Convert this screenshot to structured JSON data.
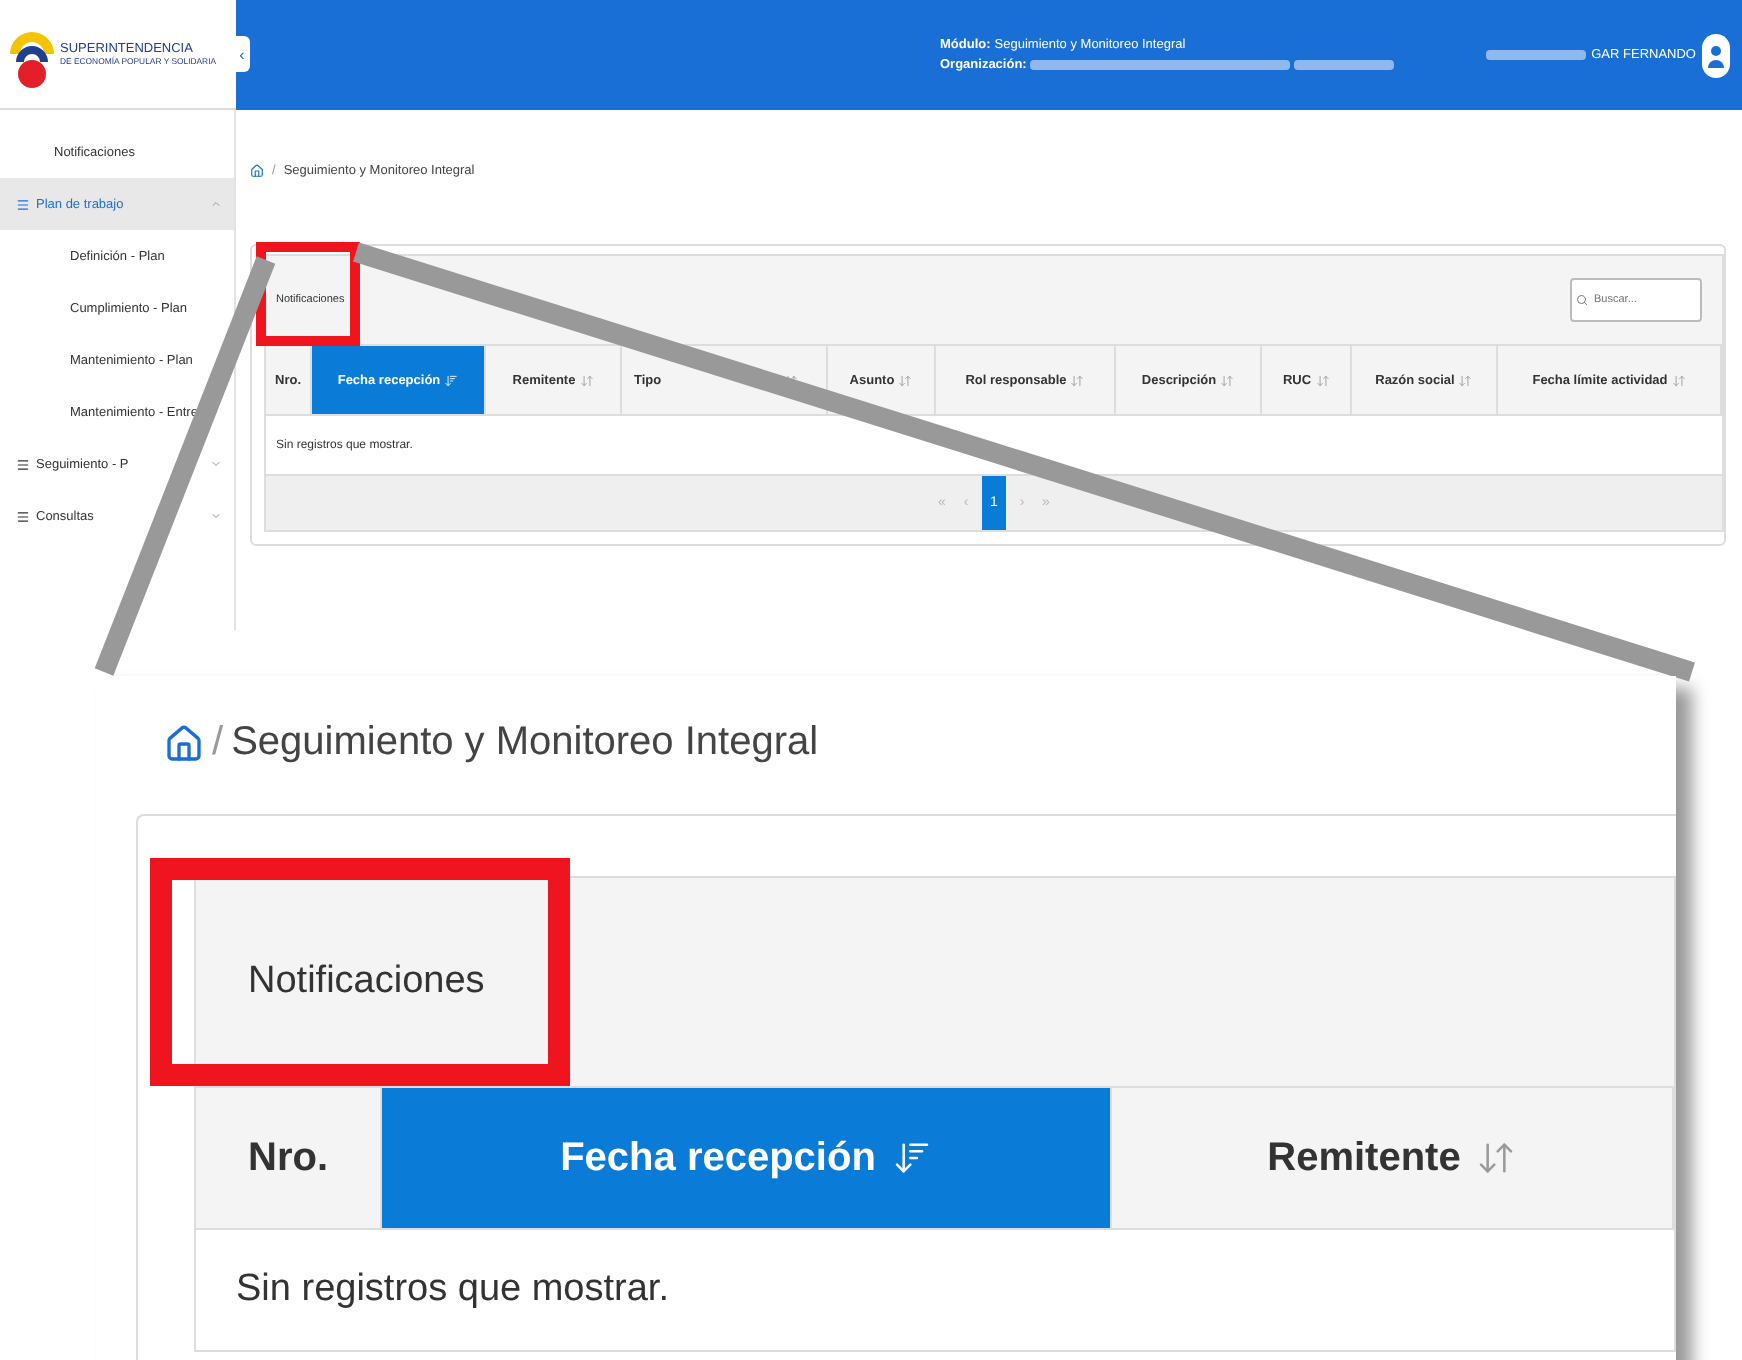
{
  "header": {
    "logo_text": "SUPERINTENDENCIA",
    "logo_subtext": "DE ECONOMÍA POPULAR Y SOLIDARIA",
    "collapse": "‹",
    "module_label": "Módulo:",
    "module": "Seguimiento y Monitoreo Integral",
    "organization_label": "Organización:",
    "user": "GAR FERNANDO"
  },
  "sidebar": {
    "items": [
      {
        "label": "Notificaciones",
        "kind": "link",
        "selected": false
      },
      {
        "label": "Plan de trabajo",
        "kind": "group",
        "selected": true,
        "expanded": true,
        "children": [
          {
            "label": "Definición - Plan"
          },
          {
            "label": "Cumplimiento - Plan"
          },
          {
            "label": "Mantenimiento - Plan"
          },
          {
            "label": "Mantenimiento - Entre"
          }
        ]
      },
      {
        "label": "Seguimiento - P",
        "kind": "group",
        "selected": false,
        "expanded": false
      },
      {
        "label": "Consultas",
        "kind": "group",
        "selected": false,
        "expanded": false
      }
    ]
  },
  "breadcrumb": {
    "separator": "/",
    "current": "Seguimiento y Monitoreo Integral"
  },
  "card": {
    "title": "Notificaciones",
    "highlighted": true,
    "search": {
      "placeholder": "Buscar..."
    },
    "columns": [
      {
        "label": "Nro.",
        "sortable": false,
        "selected": false
      },
      {
        "label": "Fecha recepción",
        "sortable": true,
        "selected": true
      },
      {
        "label": "Remitente",
        "sortable": true,
        "selected": false
      },
      {
        "label": "Tipo",
        "sortable": true,
        "selected": false
      },
      {
        "label": "Asunto",
        "sortable": true,
        "selected": false
      },
      {
        "label": "Rol responsable",
        "sortable": true,
        "selected": false
      },
      {
        "label": "Descripción",
        "sortable": true,
        "selected": false
      },
      {
        "label": "RUC",
        "sortable": true,
        "selected": false
      },
      {
        "label": "Razón social",
        "sortable": true,
        "selected": false
      },
      {
        "label": "Fecha límite actividad",
        "sortable": true,
        "selected": false
      }
    ],
    "empty": "Sin registros que mostrar.",
    "pagination": [
      {
        "label": "«",
        "selected": false
      },
      {
        "label": "‹",
        "selected": false
      },
      {
        "label": "1",
        "selected": true
      },
      {
        "label": "›",
        "selected": false
      },
      {
        "label": "»",
        "selected": false
      }
    ]
  },
  "zoom_inset": {
    "breadcrumb": {
      "separator": "/",
      "current": "Seguimiento y Monitoreo Integral"
    },
    "title": "Notificaciones",
    "highlighted": true,
    "columns": [
      {
        "label": "Nro.",
        "sortable": false,
        "selected": false
      },
      {
        "label": "Fecha recepción",
        "sortable": true,
        "selected": true
      },
      {
        "label": "Remitente",
        "sortable": true,
        "selected": false
      }
    ],
    "empty": "Sin registros que mostrar."
  }
}
